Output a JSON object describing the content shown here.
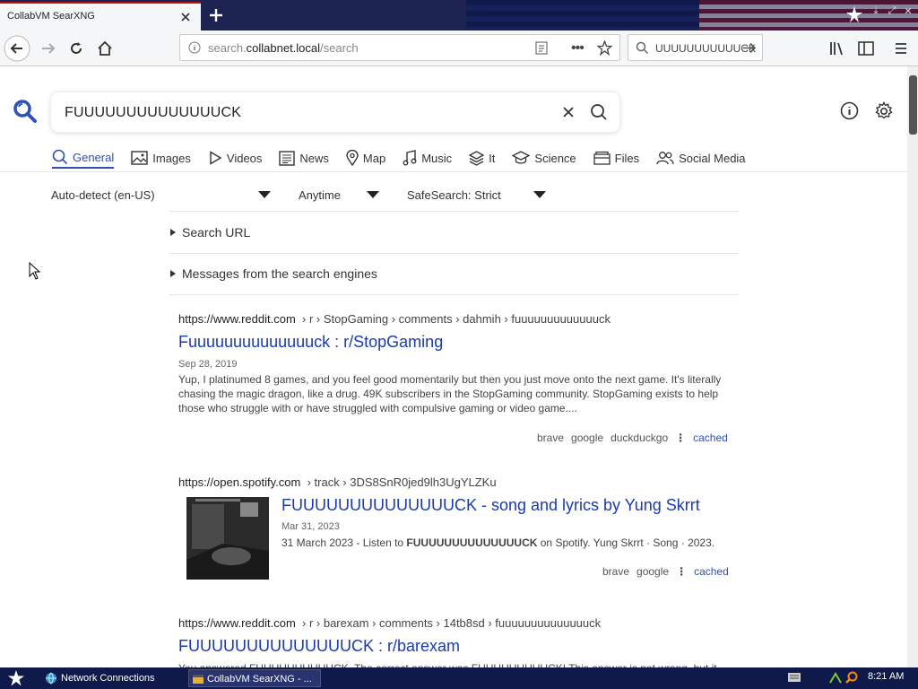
{
  "browser": {
    "tab_title": "CollabVM SearXNG",
    "url_prefix": "search.",
    "url_domain": "collabnet.local",
    "url_path": "/search",
    "search_box_value": "UUUUUUUUUUUCK"
  },
  "searxng": {
    "query": "FUUUUUUUUUUUUUUCK",
    "categories": [
      {
        "label": "General",
        "icon": "search-icon"
      },
      {
        "label": "Images",
        "icon": "image-icon"
      },
      {
        "label": "Videos",
        "icon": "play-icon"
      },
      {
        "label": "News",
        "icon": "newspaper-icon"
      },
      {
        "label": "Map",
        "icon": "map-pin-icon"
      },
      {
        "label": "Music",
        "icon": "music-icon"
      },
      {
        "label": "It",
        "icon": "layers-icon"
      },
      {
        "label": "Science",
        "icon": "graduation-cap-icon"
      },
      {
        "label": "Files",
        "icon": "files-icon"
      },
      {
        "label": "Social Media",
        "icon": "users-icon"
      }
    ],
    "filters": {
      "language": "Auto-detect (en-US)",
      "time": "Anytime",
      "safesearch": "SafeSearch: Strict"
    },
    "search_url_label": "Search URL",
    "messages_label": "Messages from the search engines"
  },
  "results": [
    {
      "host": "https://www.reddit.com",
      "path": "› r › StopGaming › comments › dahmih › fuuuuuuuuuuuuuck",
      "title": "Fuuuuuuuuuuuuuuck : r/StopGaming",
      "date": "Sep 28, 2019",
      "snippet": "Yup, I platinumed 8 games, and you feel good momentarily but then you just move onto the next game. It's literally chasing the magic dragon, like a drug. 49K subscribers in the StopGaming community. StopGaming exists to help those who struggle with or have struggled with compulsive gaming or video game....",
      "engines": [
        "brave",
        "google",
        "duckduckgo"
      ],
      "cached": "cached"
    },
    {
      "host": "https://open.spotify.com",
      "path": "› track › 3DS8SnR0jed9lh3UgYLZKu",
      "title": "FUUUUUUUUUUUUUUCK - song and lyrics by Yung Skrrt",
      "date": "Mar 31, 2023",
      "snippet_pre": "31 March 2023 - Listen to ",
      "snippet_bold": "FUUUUUUUUUUUUUUCK",
      "snippet_post": " on Spotify. Yung Skrrt · Song · 2023.",
      "engines": [
        "brave",
        "google"
      ],
      "cached": "cached"
    },
    {
      "host": "https://www.reddit.com",
      "path": "› r › barexam › comments › 14tb8sd › fuuuuuuuuuuuuuuck",
      "title": "FUUUUUUUUUUUUUUCK : r/barexam",
      "snippet": "You answered FUUUUUUUUUUCK. The correct answer was FUUUUUUUUUCK! This answer is not wrong, but it"
    }
  ],
  "taskbar": {
    "item1": "Network Connections",
    "item2": "CollabVM SearXNG - ...",
    "clock": "8:21 AM"
  }
}
